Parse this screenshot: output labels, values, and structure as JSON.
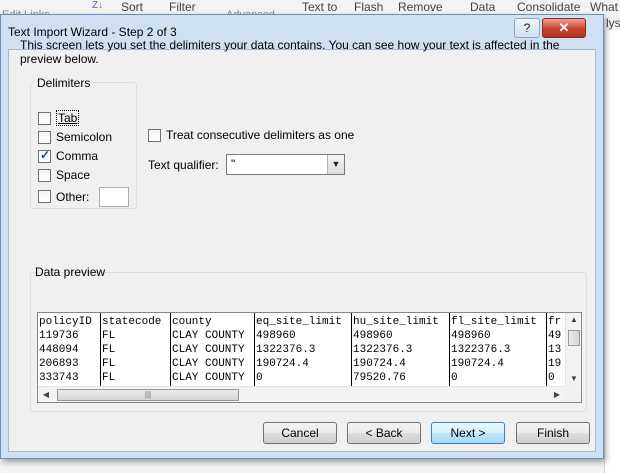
{
  "background_ribbon": {
    "items": [
      "Sort",
      "Filter",
      "Text to",
      "Flash",
      "Remove",
      "Data",
      "Consolidate",
      "What"
    ],
    "faint_items": [
      "Edit Links",
      "Advanced"
    ],
    "right_edge_text": "lys"
  },
  "dialog": {
    "title": "Text Import Wizard - Step 2 of 3",
    "help_glyph": "?",
    "close_glyph": "✕",
    "intro": "This screen lets you set the delimiters your data contains.  You can see how your text is affected in the preview below.",
    "delimiters": {
      "group_title": "Delimiters",
      "options": [
        {
          "label": "Tab",
          "checked": false
        },
        {
          "label": "Semicolon",
          "checked": false
        },
        {
          "label": "Comma",
          "checked": true
        },
        {
          "label": "Space",
          "checked": false
        },
        {
          "label": "Other:",
          "checked": false
        }
      ],
      "other_value": ""
    },
    "consecutive": {
      "label": "Treat consecutive delimiters as one",
      "checked": false
    },
    "qualifier": {
      "label": "Text qualifier:",
      "value": "\""
    },
    "preview": {
      "label": "Data preview",
      "columns": [
        "policyID",
        "statecode",
        "county",
        "eq_site_limit",
        "hu_site_limit",
        "fl_site_limit",
        "fr"
      ],
      "rows": [
        [
          "119736",
          "FL",
          "CLAY COUNTY",
          "498960",
          "498960",
          "498960",
          "49"
        ],
        [
          "448094",
          "FL",
          "CLAY COUNTY",
          "1322376.3",
          "1322376.3",
          "1322376.3",
          "13"
        ],
        [
          "206893",
          "FL",
          "CLAY COUNTY",
          "190724.4",
          "190724.4",
          "190724.4",
          "19"
        ],
        [
          "333743",
          "FL",
          "CLAY COUNTY",
          "0",
          "79520.76",
          "0",
          "0"
        ]
      ]
    },
    "buttons": {
      "cancel": "Cancel",
      "back": "< Back",
      "next": "Next >",
      "finish": "Finish"
    }
  },
  "colors": {
    "dialog_frame": "#cfe0f2",
    "client": "#f0f0f0",
    "close_red": "#c7432f",
    "default_button": "#a7d9f5"
  }
}
